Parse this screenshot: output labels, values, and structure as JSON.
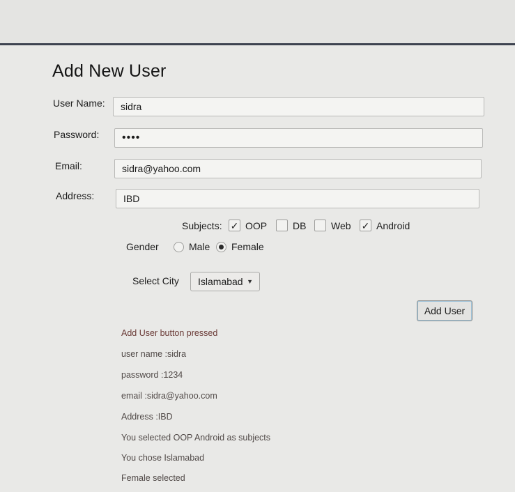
{
  "form": {
    "title": "Add New User",
    "user_name": {
      "label": "User Name:",
      "value": "sidra"
    },
    "password": {
      "label": "Password:",
      "value": "••••"
    },
    "email": {
      "label": "Email:",
      "value": "sidra@yahoo.com"
    },
    "address": {
      "label": "Address:",
      "value": "IBD"
    },
    "subjects": {
      "label": "Subjects:",
      "options": [
        {
          "label": "OOP",
          "checked": true
        },
        {
          "label": "DB",
          "checked": false
        },
        {
          "label": "Web",
          "checked": false
        },
        {
          "label": "Android",
          "checked": true
        }
      ],
      "check_mark": "✓"
    },
    "gender": {
      "label": "Gender",
      "male_label": "Male",
      "female_label": "Female",
      "selected": "Female"
    },
    "city": {
      "label": "Select City",
      "value": "Islamabad",
      "arrow": "▼"
    },
    "add_button_label": "Add User"
  },
  "log": [
    "Add User button pressed",
    "user name :sidra",
    "password :1234",
    "email :sidra@yahoo.com",
    "Address :IBD",
    "You selected OOP Android as subjects",
    "You chose Islamabad",
    "Female selected"
  ]
}
